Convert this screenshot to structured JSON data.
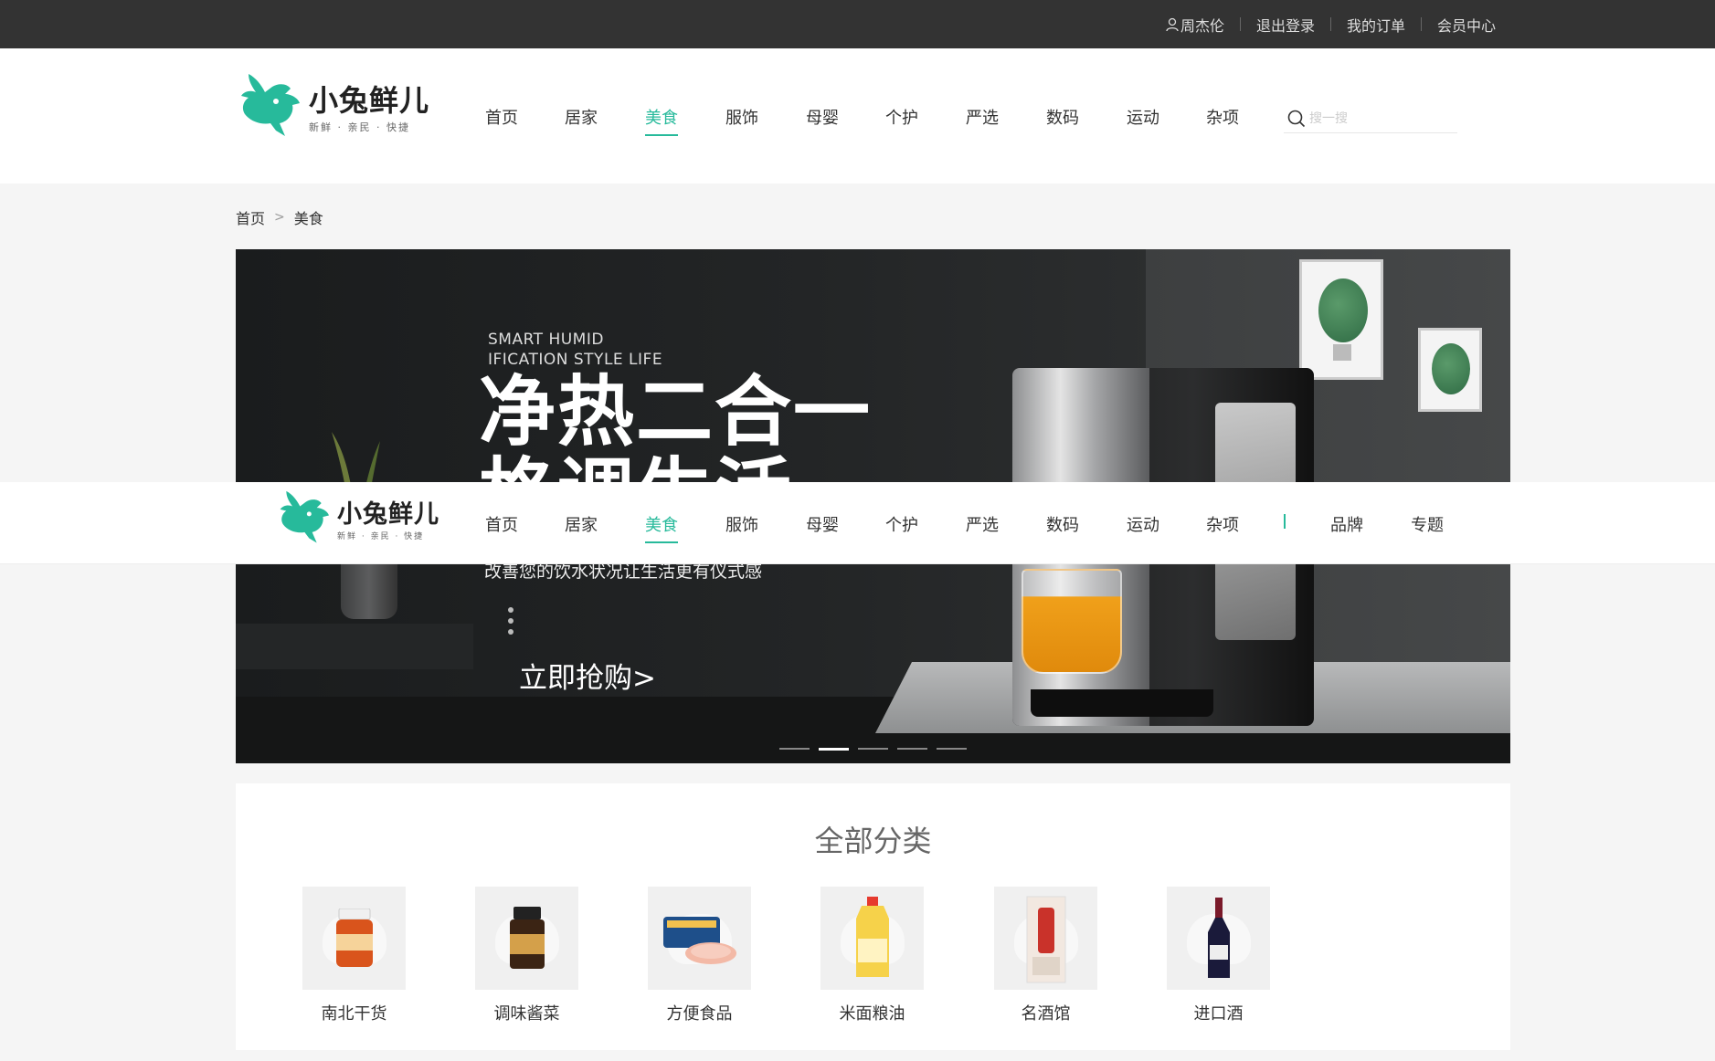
{
  "topbar": {
    "items": [
      "周杰伦",
      "退出登录",
      "我的订单",
      "会员中心"
    ]
  },
  "logo": {
    "title": "小兔鲜儿",
    "slogan": "新鲜 · 亲民 · 快捷",
    "brand_color": "#27ba9b"
  },
  "nav": {
    "items": [
      "首页",
      "居家",
      "美食",
      "服饰",
      "母婴",
      "个护",
      "严选",
      "数码",
      "运动",
      "杂项"
    ],
    "active": "美食"
  },
  "search": {
    "placeholder": "搜一搜",
    "icon": "search-icon"
  },
  "sticky": {
    "extra_items": [
      "品牌",
      "专题"
    ]
  },
  "breadcrumb": {
    "items": [
      "首页",
      "美食"
    ],
    "separator": ">"
  },
  "banner": {
    "en_line1": "SMART HUMID",
    "en_line2": "IFICATION STYLE LIFE",
    "title_line1": "净热二合一",
    "title_line2": "格调生活",
    "desc": "改善您的饮水状况让生活更有仪式感",
    "cta": "立即抢购>",
    "slide_count": 5,
    "active_slide": 2
  },
  "categories": {
    "title": "全部分类",
    "items": [
      "南北干货",
      "调味酱菜",
      "方便食品",
      "米面粮油",
      "名酒馆",
      "进口酒"
    ]
  }
}
